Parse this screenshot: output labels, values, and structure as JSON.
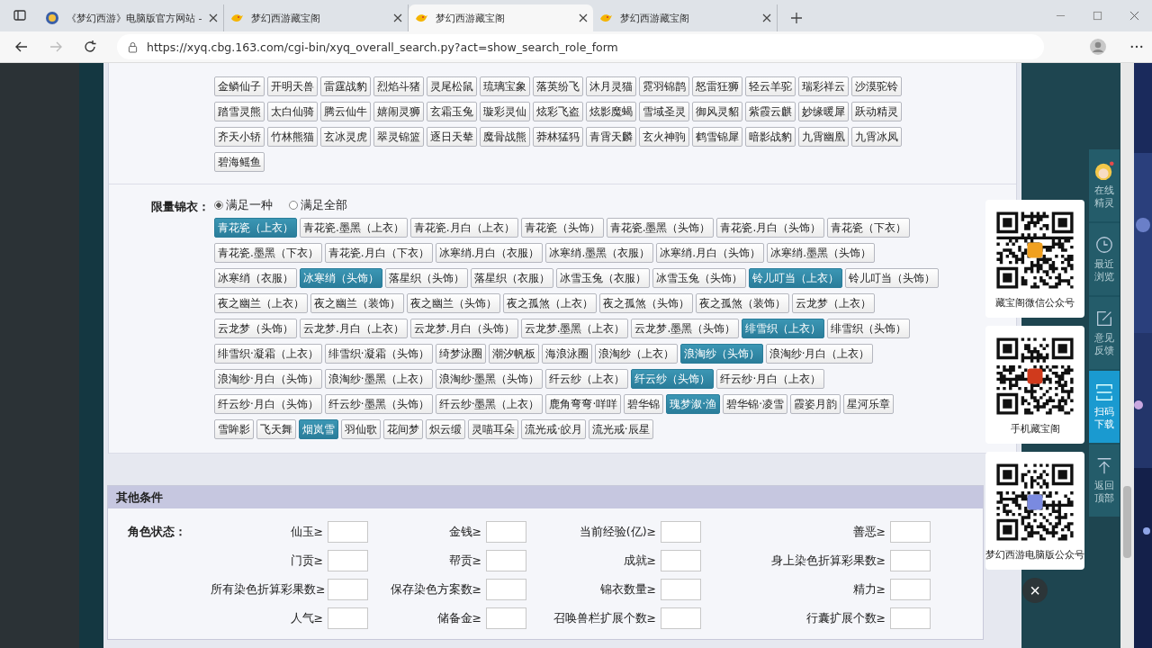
{
  "browser": {
    "tabs": [
      {
        "title": "《梦幻西游》电脑版官方网站 -",
        "selected": false,
        "kind": "site"
      },
      {
        "title": "梦幻西游藏宝阁",
        "selected": false,
        "kind": "cbg"
      },
      {
        "title": "梦幻西游藏宝阁",
        "selected": true,
        "kind": "cbg"
      },
      {
        "title": "梦幻西游藏宝阁",
        "selected": false,
        "kind": "cbg"
      }
    ],
    "url": "https://xyq.cbg.163.com/cgi-bin/xyq_overall_search.py?act=show_search_role_form"
  },
  "mount_rows": [
    {
      "tags": [
        {
          "label": "金鳞仙子",
          "selected": false
        },
        {
          "label": "开明天兽",
          "selected": false
        },
        {
          "label": "雷霆战豹",
          "selected": false
        },
        {
          "label": "烈焰斗猪",
          "selected": false
        },
        {
          "label": "灵尾松鼠",
          "selected": false
        },
        {
          "label": "琉璃宝象",
          "selected": false
        },
        {
          "label": "落英纷飞",
          "selected": false
        },
        {
          "label": "沐月灵猫",
          "selected": false
        },
        {
          "label": "霓羽锦鹊",
          "selected": false
        },
        {
          "label": "怒雷狂狮",
          "selected": false
        },
        {
          "label": "轻云羊驼",
          "selected": false
        },
        {
          "label": "瑞彩祥云",
          "selected": false
        },
        {
          "label": "沙漠驼铃",
          "selected": false
        }
      ]
    },
    {
      "tags": [
        {
          "label": "踏雪灵熊",
          "selected": false
        },
        {
          "label": "太白仙骑",
          "selected": false
        },
        {
          "label": "腾云仙牛",
          "selected": false
        },
        {
          "label": "嬉闹灵狮",
          "selected": false
        },
        {
          "label": "玄霜玉兔",
          "selected": false
        },
        {
          "label": "璇彩灵仙",
          "selected": false
        },
        {
          "label": "炫彩飞盗",
          "selected": false
        },
        {
          "label": "炫影魔蝎",
          "selected": false
        },
        {
          "label": "雪域圣灵",
          "selected": false
        },
        {
          "label": "御风灵貂",
          "selected": false
        },
        {
          "label": "紫霞云麒",
          "selected": false
        },
        {
          "label": "妙缘暖犀",
          "selected": false
        },
        {
          "label": "跃动精灵",
          "selected": false
        }
      ]
    },
    {
      "tags": [
        {
          "label": "齐天小轿",
          "selected": false
        },
        {
          "label": "竹林熊猫",
          "selected": false
        },
        {
          "label": "玄冰灵虎",
          "selected": false
        },
        {
          "label": "翠灵锦篮",
          "selected": false
        },
        {
          "label": "逐日天辇",
          "selected": false
        },
        {
          "label": "魔骨战熊",
          "selected": false
        },
        {
          "label": "莽林猛犸",
          "selected": false
        },
        {
          "label": "青霄天麟",
          "selected": false
        },
        {
          "label": "玄火神驹",
          "selected": false
        },
        {
          "label": "鹤雪锦犀",
          "selected": false
        },
        {
          "label": "暗影战豹",
          "selected": false
        },
        {
          "label": "九霄幽凰",
          "selected": false
        },
        {
          "label": "九霄冰凤",
          "selected": false
        }
      ]
    },
    {
      "tags": [
        {
          "label": "碧海鳐鱼",
          "selected": false
        }
      ]
    }
  ],
  "outfit": {
    "label": "限量锦衣：",
    "options": [
      {
        "label": "满足一种",
        "selected": true
      },
      {
        "label": "满足全部",
        "selected": false
      }
    ],
    "rows": [
      {
        "tags": [
          {
            "label": "青花瓷（上衣）",
            "selected": true
          },
          {
            "label": "青花瓷.墨黑（上衣）",
            "selected": false
          },
          {
            "label": "青花瓷.月白（上衣）",
            "selected": false
          },
          {
            "label": "青花瓷（头饰）",
            "selected": false
          },
          {
            "label": "青花瓷.墨黑（头饰）",
            "selected": false
          },
          {
            "label": "青花瓷.月白（头饰）",
            "selected": false
          },
          {
            "label": "青花瓷（下衣）",
            "selected": false
          }
        ]
      },
      {
        "tags": [
          {
            "label": "青花瓷.墨黑（下衣）",
            "selected": false
          },
          {
            "label": "青花瓷.月白（下衣）",
            "selected": false
          },
          {
            "label": "冰寒绡.月白（衣服）",
            "selected": false
          },
          {
            "label": "冰寒绡.墨黑（衣服）",
            "selected": false
          },
          {
            "label": "冰寒绡.月白（头饰）",
            "selected": false
          },
          {
            "label": "冰寒绡.墨黑（头饰）",
            "selected": false
          }
        ]
      },
      {
        "tags": [
          {
            "label": "冰寒绡（衣服）",
            "selected": false
          },
          {
            "label": "冰寒绡（头饰）",
            "selected": true
          },
          {
            "label": "落星织（头饰）",
            "selected": false
          },
          {
            "label": "落星织（衣服）",
            "selected": false
          },
          {
            "label": "冰雪玉兔（衣服）",
            "selected": false
          },
          {
            "label": "冰雪玉兔（头饰）",
            "selected": false
          },
          {
            "label": "铃儿叮当（上衣）",
            "selected": true
          },
          {
            "label": "铃儿叮当（头饰）",
            "selected": false
          }
        ]
      },
      {
        "tags": [
          {
            "label": "夜之幽兰（上衣）",
            "selected": false
          },
          {
            "label": "夜之幽兰（装饰）",
            "selected": false
          },
          {
            "label": "夜之幽兰（头饰）",
            "selected": false
          },
          {
            "label": "夜之孤煞（上衣）",
            "selected": false
          },
          {
            "label": "夜之孤煞（头饰）",
            "selected": false
          },
          {
            "label": "夜之孤煞（装饰）",
            "selected": false
          },
          {
            "label": "云龙梦（上衣）",
            "selected": false
          }
        ]
      },
      {
        "tags": [
          {
            "label": "云龙梦（头饰）",
            "selected": false
          },
          {
            "label": "云龙梦.月白（上衣）",
            "selected": false
          },
          {
            "label": "云龙梦.月白（头饰）",
            "selected": false
          },
          {
            "label": "云龙梦.墨黑（上衣）",
            "selected": false
          },
          {
            "label": "云龙梦.墨黑（头饰）",
            "selected": false
          },
          {
            "label": "绯雪织（上衣）",
            "selected": true
          },
          {
            "label": "绯雪织（头饰）",
            "selected": false
          }
        ]
      },
      {
        "tags": [
          {
            "label": "绯雪织·凝霜（上衣）",
            "selected": false
          },
          {
            "label": "绯雪织·凝霜（头饰）",
            "selected": false
          },
          {
            "label": "绮梦泳圈",
            "selected": false
          },
          {
            "label": "潮汐帆板",
            "selected": false
          },
          {
            "label": "海浪泳圈",
            "selected": false
          },
          {
            "label": "浪淘纱（上衣）",
            "selected": false
          },
          {
            "label": "浪淘纱（头饰）",
            "selected": true
          },
          {
            "label": "浪淘纱·月白（上衣）",
            "selected": false
          }
        ]
      },
      {
        "tags": [
          {
            "label": "浪淘纱·月白（头饰）",
            "selected": false
          },
          {
            "label": "浪淘纱·墨黑（上衣）",
            "selected": false
          },
          {
            "label": "浪淘纱·墨黑（头饰）",
            "selected": false
          },
          {
            "label": "纤云纱（上衣）",
            "selected": false
          },
          {
            "label": "纤云纱（头饰）",
            "selected": true
          },
          {
            "label": "纤云纱·月白（上衣）",
            "selected": false
          }
        ]
      },
      {
        "tags": [
          {
            "label": "纤云纱·月白（头饰）",
            "selected": false
          },
          {
            "label": "纤云纱·墨黑（头饰）",
            "selected": false
          },
          {
            "label": "纤云纱·墨黑（上衣）",
            "selected": false
          },
          {
            "label": "鹿角弯弯·咩咩",
            "selected": false
          },
          {
            "label": "碧华锦",
            "selected": false
          },
          {
            "label": "瑰梦溆·渔",
            "selected": true
          },
          {
            "label": "碧华锦·凌雪",
            "selected": false
          },
          {
            "label": "霞姿月韵",
            "selected": false
          },
          {
            "label": "星河乐章",
            "selected": false
          }
        ]
      },
      {
        "tags": [
          {
            "label": "雪眸影",
            "selected": false
          },
          {
            "label": "飞天舞",
            "selected": false
          },
          {
            "label": "烟岚雪",
            "selected": true
          },
          {
            "label": "羽仙歌",
            "selected": false
          },
          {
            "label": "花间梦",
            "selected": false
          },
          {
            "label": "炽云缎",
            "selected": false
          },
          {
            "label": "灵喵耳朵",
            "selected": false
          },
          {
            "label": "流光戒·皎月",
            "selected": false
          },
          {
            "label": "流光戒·辰星",
            "selected": false
          }
        ]
      }
    ]
  },
  "other": {
    "title": "其他条件",
    "group_label": "角色状态：",
    "rows": [
      {
        "fields": [
          "仙玉≥",
          "金钱≥",
          "当前经验(亿)≥",
          "善恶≥"
        ]
      },
      {
        "fields": [
          "门贡≥",
          "帮贡≥",
          "成就≥",
          "身上染色折算彩果数≥"
        ]
      },
      {
        "fields": [
          "所有染色折算彩果数≥",
          "保存染色方案数≥",
          "锦衣数量≥",
          "精力≥"
        ]
      },
      {
        "fields": [
          "人气≥",
          "储备金≥",
          "召唤兽栏扩展个数≥",
          "行囊扩展个数≥"
        ]
      }
    ]
  },
  "qr_cards": [
    {
      "caption": "藏宝阁微信公众号"
    },
    {
      "caption": "手机藏宝阁"
    },
    {
      "caption": "梦幻西游电脑版公众号"
    }
  ],
  "close_label": "×",
  "side_menu": [
    {
      "kind": "avatar",
      "label": "在线精灵",
      "selected": false
    },
    {
      "kind": "clock",
      "label": "最近浏览",
      "selected": false
    },
    {
      "kind": "edit",
      "label": "意见反馈",
      "selected": false
    },
    {
      "kind": "scan",
      "label": "扫码下载",
      "selected": true
    },
    {
      "kind": "top",
      "label": "返回顶部",
      "selected": false
    }
  ]
}
